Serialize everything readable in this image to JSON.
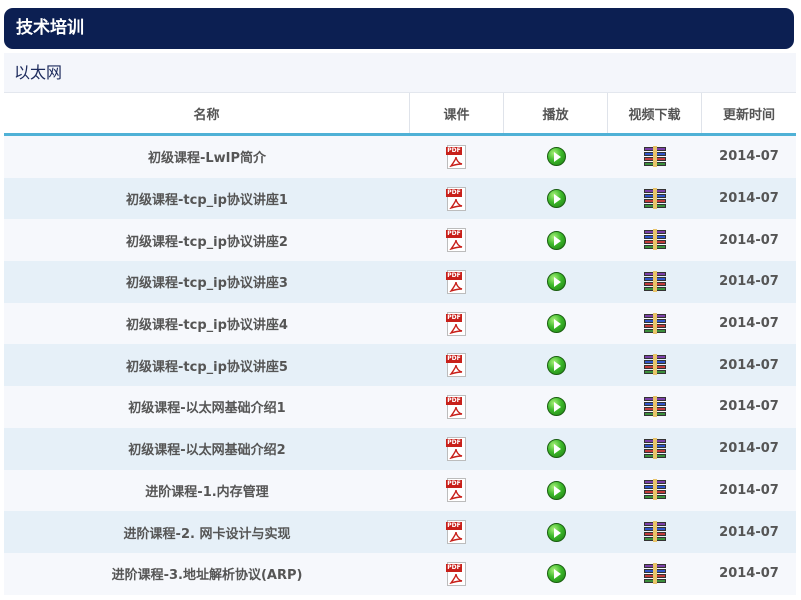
{
  "header": {
    "title": "技术培训"
  },
  "section": {
    "title": "以太网"
  },
  "columns": {
    "name": "名称",
    "courseware": "课件",
    "play": "播放",
    "video_download": "视频下载",
    "updated": "更新时间"
  },
  "icons": {
    "courseware": "pdf-icon",
    "play": "play-icon",
    "download": "archive-download-icon"
  },
  "colors": {
    "header_bg": "#0c1f52",
    "accent_line": "#4fb1d6",
    "row_odd": "#f6f8fc",
    "row_even": "#e6f0f8"
  },
  "pdf_label": "PDF",
  "rows": [
    {
      "name": "初级课程-LwIP简介",
      "date": "2014-07"
    },
    {
      "name": "初级课程-tcp_ip协议讲座1",
      "date": "2014-07"
    },
    {
      "name": "初级课程-tcp_ip协议讲座2",
      "date": "2014-07"
    },
    {
      "name": "初级课程-tcp_ip协议讲座3",
      "date": "2014-07"
    },
    {
      "name": "初级课程-tcp_ip协议讲座4",
      "date": "2014-07"
    },
    {
      "name": "初级课程-tcp_ip协议讲座5",
      "date": "2014-07"
    },
    {
      "name": "初级课程-以太网基础介绍1",
      "date": "2014-07"
    },
    {
      "name": "初级课程-以太网基础介绍2",
      "date": "2014-07"
    },
    {
      "name": "进阶课程-1.内存管理",
      "date": "2014-07"
    },
    {
      "name": "进阶课程-2. 网卡设计与实现",
      "date": "2014-07"
    },
    {
      "name": "进阶课程-3.地址解析协议(ARP)",
      "date": "2014-07"
    }
  ]
}
